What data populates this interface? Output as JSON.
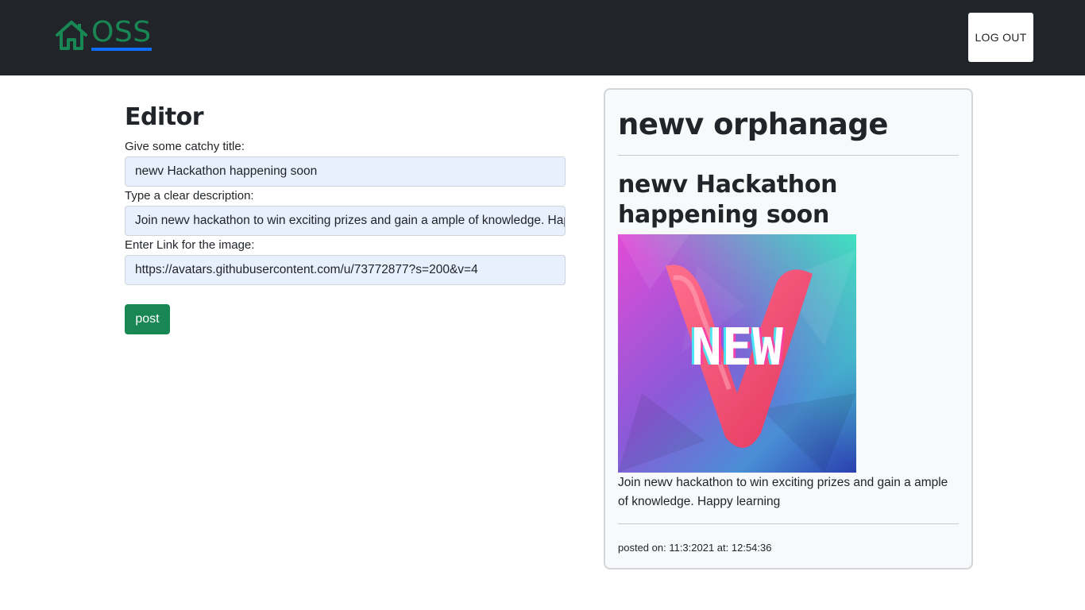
{
  "navbar": {
    "brand": "OSS",
    "home_icon": "home-icon",
    "logout_label": "LOG OUT",
    "brand_color": "#198754",
    "underline_color": "#0d6efd",
    "background": "#212529"
  },
  "editor": {
    "heading": "Editor",
    "title_label": "Give some catchy title:",
    "title_value": "newv Hackathon happening soon",
    "description_label": "Type a clear description:",
    "description_value": "Join newv hackathon to win exciting prizes and gain a ample of knowledge. Happy learning",
    "image_label": "Enter Link for the image:",
    "image_value": "https://avatars.githubusercontent.com/u/73772877?s=200&v=4",
    "post_label": "post"
  },
  "preview": {
    "org_name": "newv orphanage",
    "post_title": "newv Hackathon happening soon",
    "image_text": "NEW",
    "description": "Join newv hackathon to win exciting prizes and gain a ample of knowledge. Happy learning",
    "posted_on": "posted on: 11:3:2021 at: 12:54:36"
  }
}
